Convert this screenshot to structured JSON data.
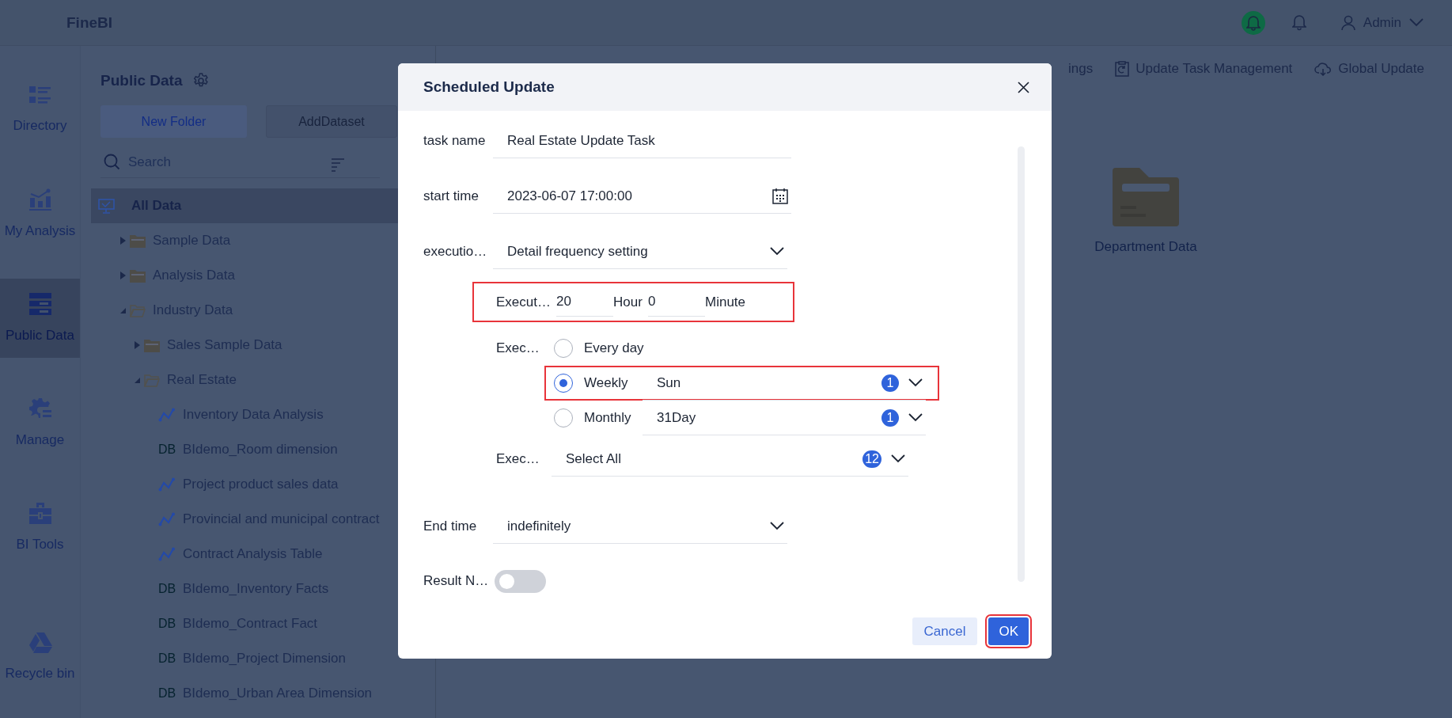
{
  "app": {
    "logo": "FineBI",
    "user": "Admin"
  },
  "nav": [
    {
      "label": "Directory",
      "selected": false
    },
    {
      "label": "My Analysis",
      "selected": false
    },
    {
      "label": "Public Data",
      "selected": true
    },
    {
      "label": "Manage",
      "selected": false
    },
    {
      "label": "BI Tools",
      "selected": false
    },
    {
      "label": "Recycle bin",
      "selected": false
    }
  ],
  "panel": {
    "title": "Public Data",
    "buttons": [
      {
        "label": "New Folder",
        "disabled": false
      },
      {
        "label": "AddDataset",
        "disabled": true
      }
    ],
    "search": {
      "placeholder": "Search"
    },
    "tree": [
      {
        "label": "All Data",
        "kind": "root",
        "selected": true,
        "children": [
          {
            "label": "Sample Data",
            "kind": "folder",
            "selected": false,
            "expanded": false
          },
          {
            "label": "Analysis Data",
            "kind": "folder",
            "selected": false,
            "expanded": false
          },
          {
            "label": "Industry Data",
            "kind": "folder",
            "selected": false,
            "expanded": true,
            "children": [
              {
                "label": "Sales Sample Data",
                "kind": "folder",
                "selected": false,
                "expanded": false
              },
              {
                "label": "Real Estate",
                "kind": "folder",
                "selected": false,
                "expanded": true,
                "children": [
                  {
                    "label": "Inventory Data Analysis",
                    "kind": "analysis",
                    "selected": false
                  },
                  {
                    "label": "BIdemo_Room dimension",
                    "kind": "db",
                    "tag": "DB",
                    "selected": false
                  },
                  {
                    "label": "Project product sales data",
                    "kind": "analysis",
                    "selected": false
                  },
                  {
                    "label": "Provincial and municipal contract",
                    "kind": "analysis",
                    "selected": false
                  },
                  {
                    "label": "Contract Analysis Table",
                    "kind": "analysis",
                    "selected": false
                  },
                  {
                    "label": "BIdemo_Inventory Facts",
                    "kind": "db",
                    "tag": "DB",
                    "selected": false
                  },
                  {
                    "label": "BIdemo_Contract Fact",
                    "kind": "db",
                    "tag": "DB",
                    "selected": false
                  },
                  {
                    "label": "BIdemo_Project Dimension",
                    "kind": "db",
                    "tag": "DB",
                    "selected": false
                  },
                  {
                    "label": "BIdemo_Urban Area Dimension",
                    "kind": "db",
                    "tag": "DB",
                    "selected": false
                  }
                ]
              }
            ]
          }
        ]
      }
    ]
  },
  "toolbar": [
    {
      "label": "ings",
      "kind": "text"
    },
    {
      "label": "Update Task Management",
      "kind": "tasks"
    },
    {
      "label": "Global Update",
      "kind": "cloud"
    }
  ],
  "content": {
    "folders": [
      {
        "label": "Department Data"
      }
    ]
  },
  "dialog": {
    "title": "Scheduled Update",
    "task_name": {
      "label": "task name",
      "value": "Real Estate Update Task"
    },
    "start_time": {
      "label": "start time",
      "value": "2023-06-07 17:00:00"
    },
    "execution": {
      "label": "executio…",
      "value": "Detail frequency setting"
    },
    "time": {
      "label": "Execut…",
      "hour": "20",
      "hour_unit": "Hour",
      "minute": "0",
      "minute_unit": "Minute",
      "highlighted": true
    },
    "frequency": {
      "label": "Exec…",
      "options": [
        {
          "label": "Every day",
          "selected": false
        },
        {
          "label": "Weekly",
          "selected": true,
          "value": "Sun",
          "count": "1",
          "highlighted": true
        },
        {
          "label": "Monthly",
          "selected": false,
          "value": "31Day",
          "count": "1"
        }
      ]
    },
    "months": {
      "label": "Exec…",
      "value": "Select All",
      "count": "12"
    },
    "end_time": {
      "label": "End time",
      "value": "indefinitely"
    },
    "result_notice": {
      "label": "Result N…",
      "on": false
    },
    "buttons": [
      {
        "label": "Cancel",
        "kind": "secondary",
        "highlighted": false
      },
      {
        "label": "OK",
        "kind": "primary",
        "highlighted": true
      }
    ]
  }
}
